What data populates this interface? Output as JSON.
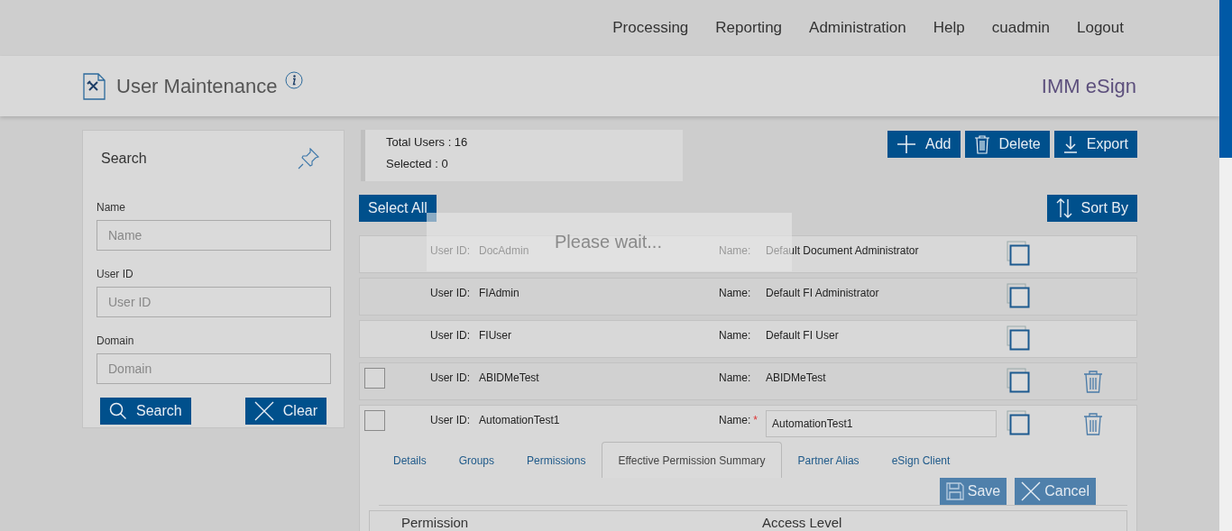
{
  "nav": [
    "Processing",
    "Reporting",
    "Administration",
    "Help",
    "cuadmin",
    "Logout"
  ],
  "header": {
    "title": "User Maintenance",
    "product": "IMM eSign"
  },
  "search_panel": {
    "title": "Search",
    "fields": [
      {
        "label": "Name",
        "placeholder": "Name"
      },
      {
        "label": "User ID",
        "placeholder": "User ID"
      },
      {
        "label": "Domain",
        "placeholder": "Domain"
      }
    ],
    "buttons": [
      {
        "label": "Search",
        "kind": "search"
      },
      {
        "label": "Clear",
        "kind": "clear"
      }
    ]
  },
  "summary": {
    "total": "Total Users : 16",
    "selected": "Selected : 0"
  },
  "actions": [
    {
      "label": "Add",
      "kind": "add"
    },
    {
      "label": "Delete",
      "kind": "delete"
    },
    {
      "label": "Export",
      "kind": "export"
    }
  ],
  "select_all": "Select All",
  "sort": "Sort By",
  "loading": "Please wait...",
  "users": [
    {
      "kind": "system",
      "expanded": false,
      "id_label": "User ID:",
      "id": "DocAdmin",
      "name_label": "Name:",
      "name": "Default Document Administrator"
    },
    {
      "kind": "system",
      "expanded": false,
      "id_label": "User ID:",
      "id": "FIAdmin",
      "name_label": "Name:",
      "name": "Default FI Administrator"
    },
    {
      "kind": "system",
      "expanded": false,
      "id_label": "User ID:",
      "id": "FIUser",
      "name_label": "Name:",
      "name": "Default FI User"
    },
    {
      "kind": "user",
      "checked": false,
      "expanded": false,
      "id_label": "User ID:",
      "id": "ABIDMeTest",
      "name_label": "Name:",
      "name": "ABIDMeTest"
    },
    {
      "kind": "user",
      "checked": false,
      "expanded": true,
      "id_label": "User ID:",
      "id": "AutomationTest1",
      "name_label": "Name:",
      "required_mark": "*",
      "name": "AutomationTest1"
    }
  ],
  "detail": {
    "tabs": [
      {
        "label": "Details",
        "selected": false
      },
      {
        "label": "Groups",
        "selected": false
      },
      {
        "label": "Permissions",
        "selected": false
      },
      {
        "label": "Effective Permission Summary",
        "selected": true
      },
      {
        "label": "Partner Alias",
        "selected": false
      },
      {
        "label": "eSign Client",
        "selected": false
      }
    ],
    "buttons": [
      {
        "label": "Save",
        "kind": "save",
        "disabled": true
      },
      {
        "label": "Cancel",
        "kind": "cancel",
        "disabled": true
      }
    ],
    "columns": [
      "Permission",
      "Access Level"
    ]
  }
}
